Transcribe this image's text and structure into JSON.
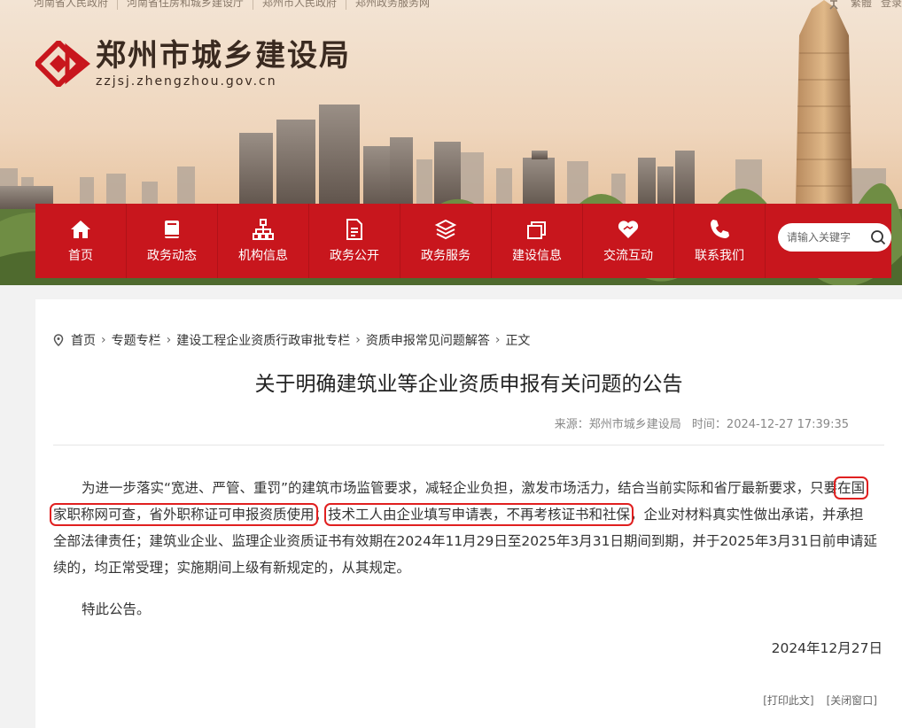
{
  "topbar": {
    "links": [
      "河南省人民政府",
      "河南省住房和城乡建设厅",
      "郑州市人民政府",
      "郑州政务服务网"
    ],
    "lang": "繁體",
    "login": "登录"
  },
  "logo": {
    "title": "郑州市城乡建设局",
    "url": "zzjsj.zhengzhou.gov.cn"
  },
  "nav": {
    "items": [
      {
        "label": "首页",
        "icon": "home-icon"
      },
      {
        "label": "政务动态",
        "icon": "book-icon"
      },
      {
        "label": "机构信息",
        "icon": "org-chart-icon"
      },
      {
        "label": "政务公开",
        "icon": "document-icon"
      },
      {
        "label": "政务服务",
        "icon": "layers-icon"
      },
      {
        "label": "建设信息",
        "icon": "stack-icon"
      },
      {
        "label": "交流互动",
        "icon": "heart-handshake-icon"
      },
      {
        "label": "联系我们",
        "icon": "phone-icon"
      }
    ],
    "search_placeholder": "请输入关键字"
  },
  "breadcrumb": [
    "首页",
    "专题专栏",
    "建设工程企业资质行政审批专栏",
    "资质申报常见问题解答",
    "正文"
  ],
  "article": {
    "title": "关于明确建筑业等企业资质申报有关问题的公告",
    "source_label": "来源：",
    "source": "郑州市城乡建设局",
    "time_label": "时间：",
    "time": "2024-12-27 17:39:35",
    "p1_a": "为进一步落实“宽进、严管、重罚”的建筑市场监管要求，减轻企业负担，激发市场活力，结合当前实际和省厅最新要求，只要",
    "p1_hl1": "在国家职称网可查，省外职称证可申报资质使用",
    "p1_b": "；",
    "p1_hl2": "技术工人由企业填写申请表，不再考核证书和社保",
    "p1_c": "，企业对材料真实性做出承诺，并承担全部法律责任；建筑业企业、监理企业资质证书有效期在2024年11月29日至2025年3月31日期间到期，并于2025年3月31日前申请延续的，均正常受理；实施期间上级有新规定的，从其规定。",
    "p2": "特此公告。",
    "date": "2024年12月27日"
  },
  "actions": {
    "print": "[打印此文]",
    "close": "[关闭窗口]"
  },
  "colors": {
    "nav_red": "#c8161d",
    "highlight_red": "#e02020"
  }
}
